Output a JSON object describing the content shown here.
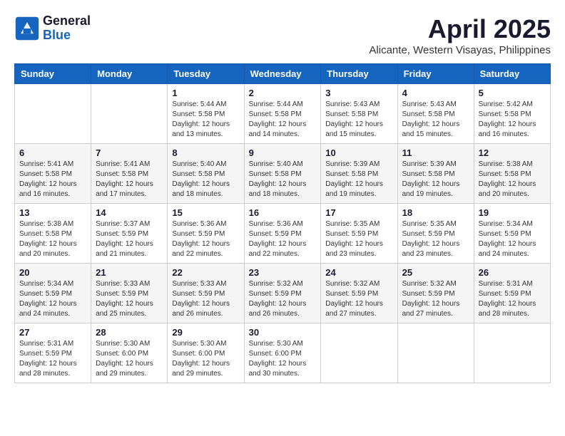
{
  "header": {
    "logo": {
      "line1": "General",
      "line2": "Blue"
    },
    "title": "April 2025",
    "location": "Alicante, Western Visayas, Philippines"
  },
  "weekdays": [
    "Sunday",
    "Monday",
    "Tuesday",
    "Wednesday",
    "Thursday",
    "Friday",
    "Saturday"
  ],
  "weeks": [
    [
      {
        "day": "",
        "info": ""
      },
      {
        "day": "",
        "info": ""
      },
      {
        "day": "1",
        "info": "Sunrise: 5:44 AM\nSunset: 5:58 PM\nDaylight: 12 hours\nand 13 minutes."
      },
      {
        "day": "2",
        "info": "Sunrise: 5:44 AM\nSunset: 5:58 PM\nDaylight: 12 hours\nand 14 minutes."
      },
      {
        "day": "3",
        "info": "Sunrise: 5:43 AM\nSunset: 5:58 PM\nDaylight: 12 hours\nand 15 minutes."
      },
      {
        "day": "4",
        "info": "Sunrise: 5:43 AM\nSunset: 5:58 PM\nDaylight: 12 hours\nand 15 minutes."
      },
      {
        "day": "5",
        "info": "Sunrise: 5:42 AM\nSunset: 5:58 PM\nDaylight: 12 hours\nand 16 minutes."
      }
    ],
    [
      {
        "day": "6",
        "info": "Sunrise: 5:41 AM\nSunset: 5:58 PM\nDaylight: 12 hours\nand 16 minutes."
      },
      {
        "day": "7",
        "info": "Sunrise: 5:41 AM\nSunset: 5:58 PM\nDaylight: 12 hours\nand 17 minutes."
      },
      {
        "day": "8",
        "info": "Sunrise: 5:40 AM\nSunset: 5:58 PM\nDaylight: 12 hours\nand 18 minutes."
      },
      {
        "day": "9",
        "info": "Sunrise: 5:40 AM\nSunset: 5:58 PM\nDaylight: 12 hours\nand 18 minutes."
      },
      {
        "day": "10",
        "info": "Sunrise: 5:39 AM\nSunset: 5:58 PM\nDaylight: 12 hours\nand 19 minutes."
      },
      {
        "day": "11",
        "info": "Sunrise: 5:39 AM\nSunset: 5:58 PM\nDaylight: 12 hours\nand 19 minutes."
      },
      {
        "day": "12",
        "info": "Sunrise: 5:38 AM\nSunset: 5:58 PM\nDaylight: 12 hours\nand 20 minutes."
      }
    ],
    [
      {
        "day": "13",
        "info": "Sunrise: 5:38 AM\nSunset: 5:58 PM\nDaylight: 12 hours\nand 20 minutes."
      },
      {
        "day": "14",
        "info": "Sunrise: 5:37 AM\nSunset: 5:59 PM\nDaylight: 12 hours\nand 21 minutes."
      },
      {
        "day": "15",
        "info": "Sunrise: 5:36 AM\nSunset: 5:59 PM\nDaylight: 12 hours\nand 22 minutes."
      },
      {
        "day": "16",
        "info": "Sunrise: 5:36 AM\nSunset: 5:59 PM\nDaylight: 12 hours\nand 22 minutes."
      },
      {
        "day": "17",
        "info": "Sunrise: 5:35 AM\nSunset: 5:59 PM\nDaylight: 12 hours\nand 23 minutes."
      },
      {
        "day": "18",
        "info": "Sunrise: 5:35 AM\nSunset: 5:59 PM\nDaylight: 12 hours\nand 23 minutes."
      },
      {
        "day": "19",
        "info": "Sunrise: 5:34 AM\nSunset: 5:59 PM\nDaylight: 12 hours\nand 24 minutes."
      }
    ],
    [
      {
        "day": "20",
        "info": "Sunrise: 5:34 AM\nSunset: 5:59 PM\nDaylight: 12 hours\nand 24 minutes."
      },
      {
        "day": "21",
        "info": "Sunrise: 5:33 AM\nSunset: 5:59 PM\nDaylight: 12 hours\nand 25 minutes."
      },
      {
        "day": "22",
        "info": "Sunrise: 5:33 AM\nSunset: 5:59 PM\nDaylight: 12 hours\nand 26 minutes."
      },
      {
        "day": "23",
        "info": "Sunrise: 5:32 AM\nSunset: 5:59 PM\nDaylight: 12 hours\nand 26 minutes."
      },
      {
        "day": "24",
        "info": "Sunrise: 5:32 AM\nSunset: 5:59 PM\nDaylight: 12 hours\nand 27 minutes."
      },
      {
        "day": "25",
        "info": "Sunrise: 5:32 AM\nSunset: 5:59 PM\nDaylight: 12 hours\nand 27 minutes."
      },
      {
        "day": "26",
        "info": "Sunrise: 5:31 AM\nSunset: 5:59 PM\nDaylight: 12 hours\nand 28 minutes."
      }
    ],
    [
      {
        "day": "27",
        "info": "Sunrise: 5:31 AM\nSunset: 5:59 PM\nDaylight: 12 hours\nand 28 minutes."
      },
      {
        "day": "28",
        "info": "Sunrise: 5:30 AM\nSunset: 6:00 PM\nDaylight: 12 hours\nand 29 minutes."
      },
      {
        "day": "29",
        "info": "Sunrise: 5:30 AM\nSunset: 6:00 PM\nDaylight: 12 hours\nand 29 minutes."
      },
      {
        "day": "30",
        "info": "Sunrise: 5:30 AM\nSunset: 6:00 PM\nDaylight: 12 hours\nand 30 minutes."
      },
      {
        "day": "",
        "info": ""
      },
      {
        "day": "",
        "info": ""
      },
      {
        "day": "",
        "info": ""
      }
    ]
  ]
}
